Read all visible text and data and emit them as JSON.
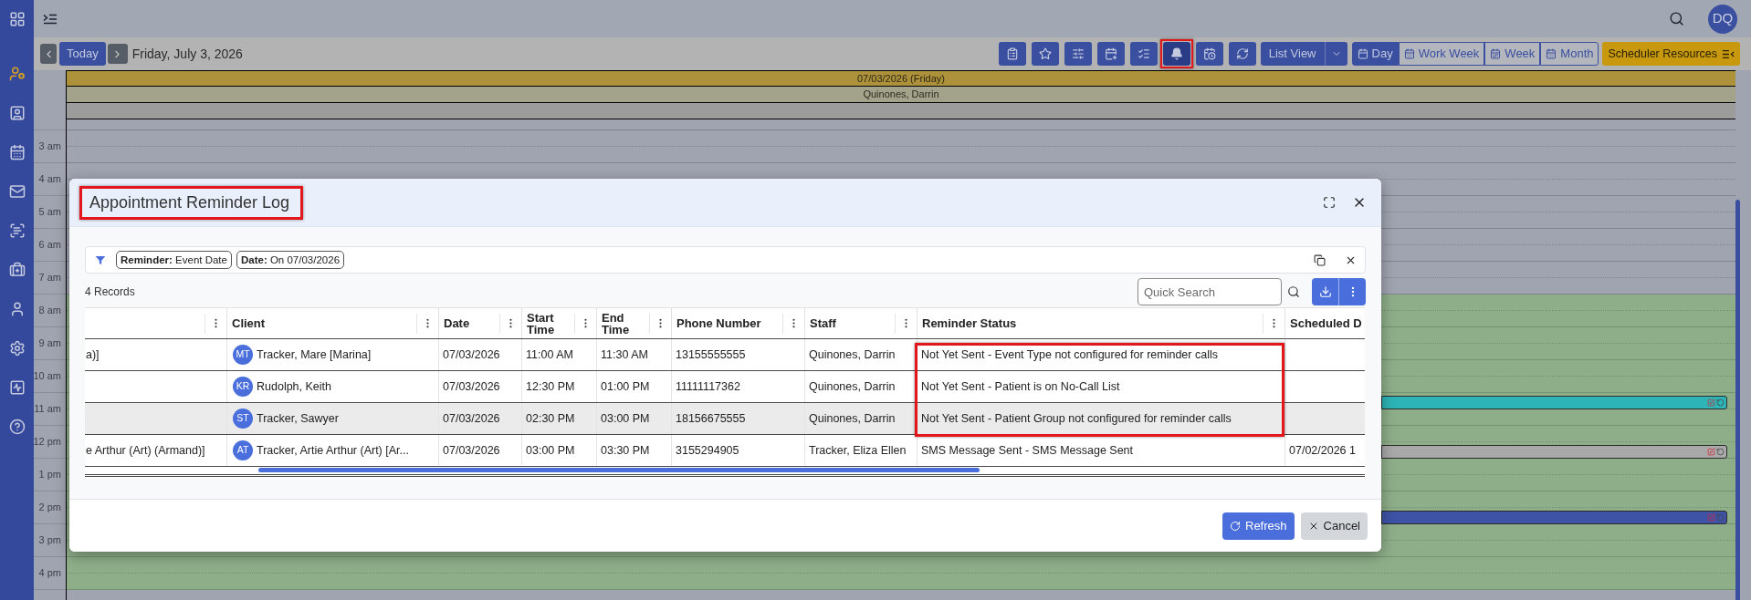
{
  "sidebar": {
    "items": [
      {
        "selected": false
      },
      {
        "selected": true
      },
      {
        "selected": false
      },
      {
        "selected": false
      },
      {
        "selected": false
      },
      {
        "selected": false
      },
      {
        "selected": false
      },
      {
        "selected": false
      },
      {
        "selected": false
      },
      {
        "selected": false
      },
      {
        "selected": false
      }
    ]
  },
  "top_bar": {
    "avatar": "DQ"
  },
  "toolbar": {
    "today": "Today",
    "date": "Friday, July 3, 2026",
    "icon_buttons": [
      {
        "highlighted": false
      },
      {
        "highlighted": false
      },
      {
        "highlighted": false
      },
      {
        "highlighted": false
      },
      {
        "highlighted": false
      },
      {
        "highlighted": true
      },
      {
        "highlighted": false
      },
      {
        "highlighted": false
      }
    ],
    "list_view": "List View",
    "views": [
      {
        "label": "Day",
        "selected": true
      },
      {
        "label": "Work Week",
        "selected": false
      },
      {
        "label": "Week",
        "selected": false
      },
      {
        "label": "Month",
        "selected": false
      }
    ],
    "resources": "Scheduler Resources"
  },
  "calendar": {
    "date_header": "07/03/2026 (Friday)",
    "resource": "Quinones, Darrin",
    "hours": [
      {
        "label": "3 am",
        "working": false
      },
      {
        "label": "4 am",
        "working": false
      },
      {
        "label": "5 am",
        "working": false
      },
      {
        "label": "6 am",
        "working": false
      },
      {
        "label": "7 am",
        "working": false
      },
      {
        "label": "8 am",
        "working": true
      },
      {
        "label": "9 am",
        "working": true
      },
      {
        "label": "10 am",
        "working": true
      },
      {
        "label": "11 am",
        "working": true,
        "event": {
          "half_past": false,
          "color": "#2db4b6"
        }
      },
      {
        "label": "12 pm",
        "working": true,
        "event": {
          "half_past": true,
          "color": "#a9a9a9"
        }
      },
      {
        "label": "1 pm",
        "working": true
      },
      {
        "label": "2 pm",
        "working": true,
        "event": {
          "half_past": true,
          "color": "#3e53a6"
        }
      },
      {
        "label": "3 pm",
        "working": true
      },
      {
        "label": "4 pm",
        "working": true
      }
    ]
  },
  "dialog": {
    "title": "Appointment Reminder Log",
    "title_highlighted": true,
    "filters": [
      "**Reminder:** Event Date",
      "**Date:** On 07/03/2026"
    ],
    "record_count": "4 Records",
    "search": {
      "placeholder": "Quick Search"
    },
    "table": {
      "columns": [
        {
          "kind": "unlabeled"
        },
        {
          "kind": "labeled",
          "label": "Client"
        },
        {
          "kind": "labeled",
          "label": "Date"
        },
        {
          "kind": "labeled",
          "label": "Start Time"
        },
        {
          "kind": "labeled",
          "label": "End Time"
        },
        {
          "kind": "labeled",
          "label": "Phone Number"
        },
        {
          "kind": "labeled",
          "label": "Staff"
        },
        {
          "kind": "labeled",
          "label": "Reminder Status"
        },
        {
          "kind": "labeled",
          "label": "Scheduled D"
        }
      ],
      "rows": [
        {
          "column_1": "a)]",
          "initials": "MT",
          "client": "Tracker, Mare [Marina]",
          "date": "07/03/2026",
          "start_time": "11:00 AM",
          "end_time": "11:30 AM",
          "phone": "13155555555",
          "staff": "Quinones, Darrin",
          "reminder_status": "Not Yet Sent - Event Type not configured for reminder calls",
          "selected": false,
          "status_highlighted": true
        },
        {
          "initials": "KR",
          "client": "Rudolph, Keith",
          "date": "07/03/2026",
          "start_time": "12:30 PM",
          "end_time": "01:00 PM",
          "phone": "11111117362",
          "staff": "Quinones, Darrin",
          "reminder_status": "Not Yet Sent - Patient is on No-Call List",
          "selected": false,
          "status_highlighted": true
        },
        {
          "initials": "ST",
          "client": "Tracker, Sawyer",
          "date": "07/03/2026",
          "start_time": "02:30 PM",
          "end_time": "03:00 PM",
          "phone": "18156675555",
          "staff": "Quinones, Darrin",
          "reminder_status": "Not Yet Sent - Patient Group not configured for reminder calls",
          "selected": true,
          "status_highlighted": true
        },
        {
          "column_1": "e Arthur (Art) (Armand)]",
          "initials": "AT",
          "client": "Tracker, Artie Arthur (Art) [Ar...",
          "date": "07/03/2026",
          "start_time": "03:00 PM",
          "end_time": "03:30 PM",
          "phone": "3155294905",
          "staff": "Tracker, Eliza Ellen",
          "reminder_status": "SMS Message Sent - SMS Message Sent",
          "scheduled": "07/02/2026 1",
          "selected": false,
          "status_highlighted": false
        }
      ]
    },
    "buttons": [
      {
        "kind": "refresh",
        "label": "Refresh"
      },
      {
        "kind": "cancel",
        "label": "Cancel"
      }
    ]
  }
}
